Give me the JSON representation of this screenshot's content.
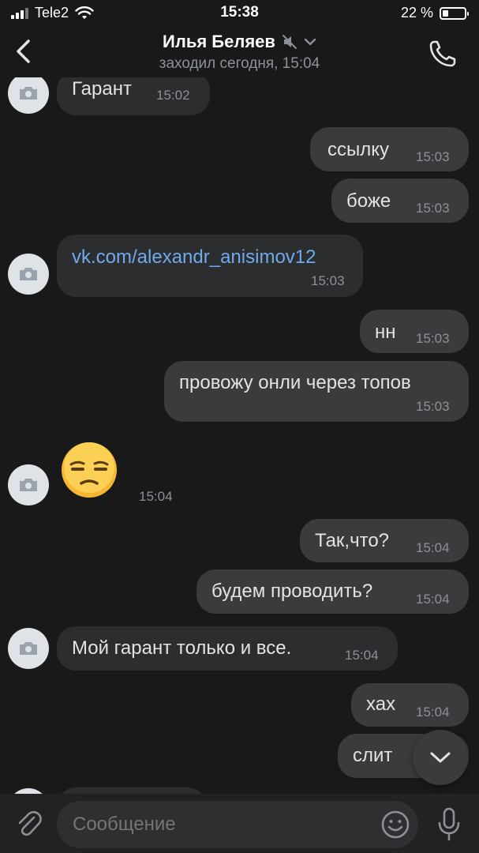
{
  "status_bar": {
    "carrier": "Tele2",
    "time": "15:38",
    "battery": "22 %"
  },
  "header": {
    "name": "Илья Беляев",
    "last_seen": "заходил сегодня, 15:04"
  },
  "messages": [
    {
      "dir": "in",
      "text": "Гарант",
      "time": "15:02"
    },
    {
      "dir": "out",
      "text": "ссылку",
      "time": "15:03"
    },
    {
      "dir": "out",
      "text": "боже",
      "time": "15:03"
    },
    {
      "dir": "in",
      "text": "vk.com/alexandr_anisimov12",
      "time": "15:03",
      "link": true
    },
    {
      "dir": "out",
      "text": "нн",
      "time": "15:03"
    },
    {
      "dir": "out",
      "text": "провожу онли через топов",
      "time": "15:03"
    },
    {
      "dir": "in",
      "text": "😒",
      "time": "15:04",
      "emoji_only": true
    },
    {
      "dir": "out",
      "text": "Так,что?",
      "time": "15:04"
    },
    {
      "dir": "out",
      "text": "будем проводить?",
      "time": "15:04"
    },
    {
      "dir": "in",
      "text": "Мой гарант только и все.",
      "time": "15:04"
    },
    {
      "dir": "out",
      "text": "хах",
      "time": "15:04"
    },
    {
      "dir": "out",
      "text": "слит",
      "time": ""
    }
  ],
  "composer": {
    "placeholder": "Сообщение"
  },
  "icons": {
    "back": "chevron-left-icon",
    "mute": "muted-speaker-icon",
    "dropdown": "chevron-down-icon",
    "call": "phone-icon",
    "avatar": "camera-icon",
    "emoji": "unamused-face-emoji",
    "scroll": "chevron-down-icon",
    "attach": "paperclip-icon",
    "smile": "smiley-icon",
    "voice": "microphone-icon"
  },
  "colors": {
    "background": "#19191a",
    "incoming_bubble": "#2c2d2e",
    "outgoing_bubble": "#3a3b3c",
    "link": "#71aaeb",
    "meta_text": "#8c9199"
  }
}
